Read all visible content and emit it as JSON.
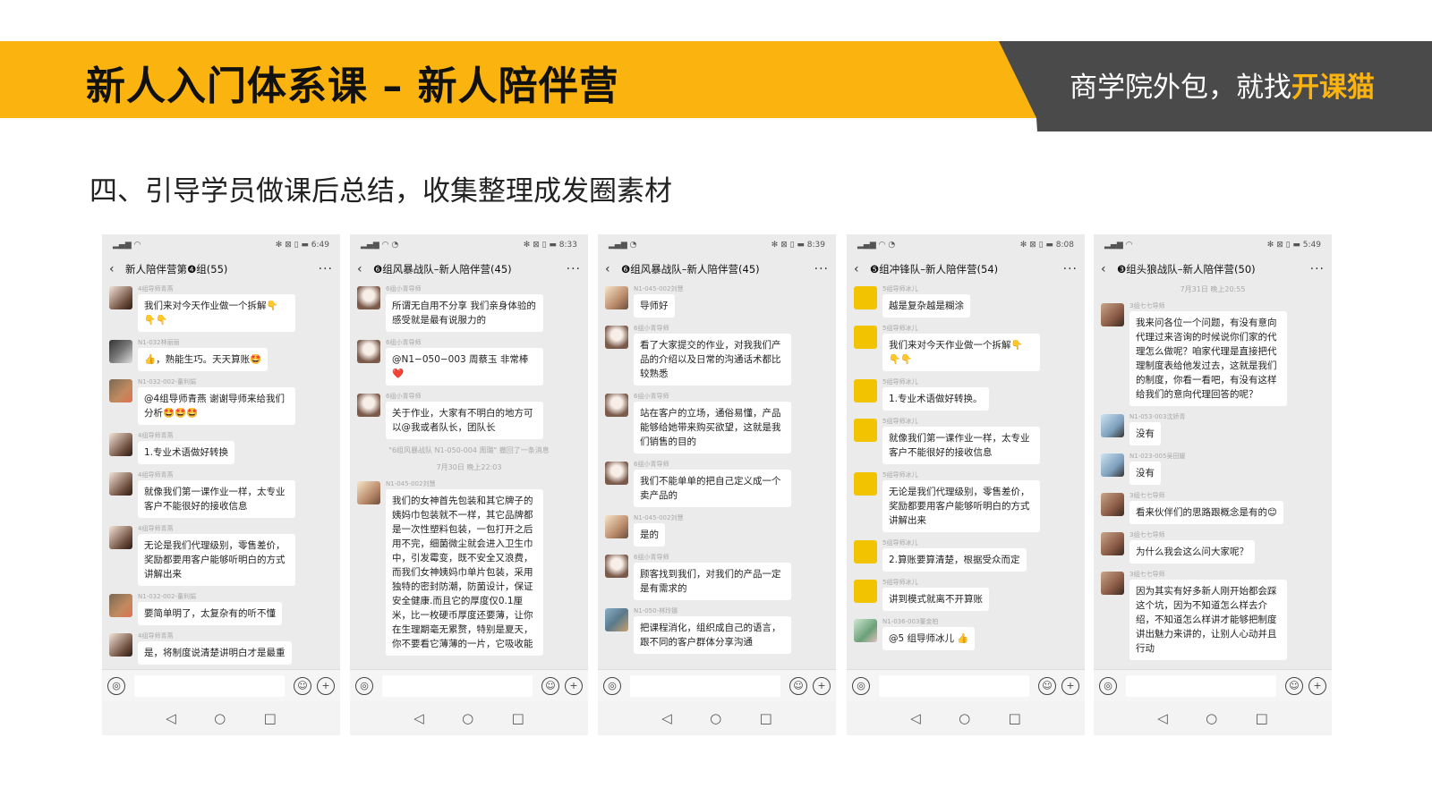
{
  "header": {
    "title": "新人入门体系课 – 新人陪伴营",
    "brand_prefix": "商学院外包，就找",
    "brand_highlight": "开课猫"
  },
  "subtitle": "四、引导学员做课后总结，收集整理成发圈素材",
  "phones": [
    {
      "status_time": "6:49",
      "chat_title": "新人陪伴营第❹组(55)",
      "messages": [
        {
          "sender": "4组导师青燕",
          "text": "我们来对今天作业做一个拆解👇👇👇"
        },
        {
          "sender": "N1-032林丽丽",
          "text": "👍，熟能生巧。天天算账🤩"
        },
        {
          "sender": "N1-032-002-董利娟",
          "text": "@4组导师青燕 谢谢导师来给我们分析🤩🤩🤩"
        },
        {
          "sender": "4组导师青燕",
          "text": "1.专业术语做好转换"
        },
        {
          "sender": "4组导师青燕",
          "text": "就像我们第一课作业一样，太专业客户不能很好的接收信息"
        },
        {
          "sender": "4组导师青燕",
          "text": "无论是我们代理级别，零售差价，奖励都要用客户能够听明白的方式讲解出来"
        },
        {
          "sender": "N1-032-002-董利娟",
          "text": "要简单明了，太复杂有的听不懂"
        },
        {
          "sender": "4组导师青燕",
          "text": "是，将制度说清楚讲明白才是最重"
        }
      ]
    },
    {
      "status_time": "8:33",
      "chat_title": "❻组风暴战队–新人陪伴营(45)",
      "messages": [
        {
          "sender": "6组小青导师",
          "text": "所谓无自用不分享 我们亲身体验的感受就是最有说服力的"
        },
        {
          "sender": "6组小青导师",
          "text": "@N1−050−003 周蔡玉 非常棒❤️"
        },
        {
          "sender": "6组小青导师",
          "text": "关于作业，大家有不明白的地方可以@我或者队长，团队长"
        }
      ],
      "system_notes": [
        "\"6组风暴战队 N1-050-004 周璐\" 撤回了一条消息",
        "7月30日 晚上22:03"
      ],
      "long_message": {
        "sender": "N1-045-002刘慧",
        "text": "我们的女神首先包装和其它牌子的姨妈巾包装就不一样，其它品牌都是一次性塑料包装，一包打开之后用不完，细菌微尘就会进入卫生巾中，引发霉变，既不安全又浪费，而我们女神姨妈巾单片包装，采用独特的密封防潮，防菌设计，保证安全健康.而且它的厚度仅0.1厘米，比一枚硬币厚度还要薄，让你在生理期毫无累赘，特别是夏天，你不要看它薄薄的一片，它吸收能"
      }
    },
    {
      "status_time": "8:39",
      "chat_title": "❻组风暴战队–新人陪伴营(45)",
      "messages": [
        {
          "sender": "N1-045-002刘慧",
          "text": "导师好"
        },
        {
          "sender": "6组小青导师",
          "text": "看了大家提交的作业，对我我们产品的介绍以及日常的沟通话术都比较熟悉"
        },
        {
          "sender": "6组小青导师",
          "text": "站在客户的立场，通俗易懂，产品能够给她带来购买欲望，这就是我们销售的目的"
        },
        {
          "sender": "6组小青导师",
          "text": "我们不能单单的把自己定义成一个卖产品的"
        },
        {
          "sender": "N1-045-002刘慧",
          "text": "是的"
        },
        {
          "sender": "6组小青导师",
          "text": "顾客找到我们，对我们的产品一定是有需求的"
        },
        {
          "sender": "N1-050-林玲娜",
          "text": "把课程消化，组织成自己的语言，跟不同的客户群体分享沟通"
        }
      ]
    },
    {
      "status_time": "8:08",
      "chat_title": "❺组冲锋队–新人陪伴营(54)",
      "messages": [
        {
          "sender": "5组导师冰儿",
          "text": "越是复杂越是糊涂"
        },
        {
          "sender": "5组导师冰儿",
          "text": "我们来对今天作业做一个拆解👇👇👇"
        },
        {
          "sender": "5组导师冰儿",
          "text": "1.专业术语做好转换。"
        },
        {
          "sender": "5组导师冰儿",
          "text": "就像我们第一课作业一样，太专业客户不能很好的接收信息"
        },
        {
          "sender": "5组导师冰儿",
          "text": "无论是我们代理级别，零售差价，奖励都要用客户能够听明白的方式讲解出来"
        },
        {
          "sender": "5组导师冰儿",
          "text": "2.算账要算清楚，根据受众而定"
        },
        {
          "sender": "5组导师冰儿",
          "text": "讲到模式就离不开算账"
        },
        {
          "sender": "N1-036-003董金柏",
          "text": "@5 组导师冰儿 👍"
        }
      ]
    },
    {
      "status_time": "5:49",
      "chat_title": "❸组头狼战队–新人陪伴营(50)",
      "date_note": "7月31日 晚上20:55",
      "messages": [
        {
          "sender": "3组七七导师",
          "text": "我来问各位一个问题，有没有意向代理过来咨询的时候说你们家的代理怎么做呢？咱家代理是直接把代理制度表给他发过去，这就是我们的制度，你看一看吧，有没有这样给我们的意向代理回答的呢？"
        },
        {
          "sender": "N1-053-003沈娇青",
          "text": "没有"
        },
        {
          "sender": "N1-023-005吴田媛",
          "text": "没有"
        },
        {
          "sender": "3组七七导师",
          "text": "看来伙伴们的思路跟概念是有的😊"
        },
        {
          "sender": "3组七七导师",
          "text": "为什么我会这么问大家呢？"
        },
        {
          "sender": "3组七七导师",
          "text": "因为其实有好多新人刚开始都会踩这个坑，因为不知道怎么样去介绍，不知道怎么样讲才能够把制度讲出魅力来讲的，让别人心动并且行动"
        }
      ]
    }
  ],
  "icons": {
    "back": "‹",
    "more": "···",
    "voice": "◎",
    "emoji": "☺",
    "plus": "+",
    "nav_back": "◁",
    "nav_home": "○",
    "nav_recent": "□"
  },
  "colors": {
    "accent_yellow": "#FBB30F",
    "brand_gray": "#4a4a4a"
  }
}
